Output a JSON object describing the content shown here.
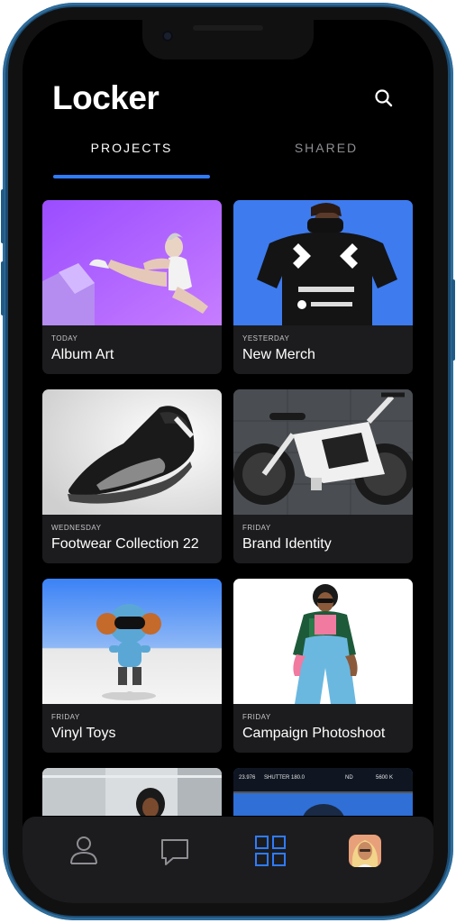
{
  "app": {
    "title": "Locker"
  },
  "tabs": [
    {
      "label": "PROJECTS",
      "active": true
    },
    {
      "label": "SHARED",
      "active": false
    }
  ],
  "projects": [
    {
      "day": "TODAY",
      "title": "Album Art",
      "thumbnail": "purple-studio-pose"
    },
    {
      "day": "YESTERDAY",
      "title": "New Merch",
      "thumbnail": "black-tshirt-on-blue"
    },
    {
      "day": "WEDNESDAY",
      "title": "Footwear Collection 22",
      "thumbnail": "black-sneaker"
    },
    {
      "day": "FRIDAY",
      "title": "Brand Identity",
      "thumbnail": "white-ebike"
    },
    {
      "day": "FRIDAY",
      "title": "Vinyl Toys",
      "thumbnail": "blue-toy-figure"
    },
    {
      "day": "FRIDAY",
      "title": "Campaign Photoshoot",
      "thumbnail": "fashion-model"
    }
  ],
  "partial_card_overlays": {
    "camera_hud": [
      "23.976",
      "SHUTTER 180.0",
      "ND",
      "5600 K"
    ]
  },
  "bottom_nav": [
    {
      "icon": "person-icon",
      "active": false
    },
    {
      "icon": "chat-icon",
      "active": false
    },
    {
      "icon": "grid-icon",
      "active": true
    },
    {
      "icon": "avatar",
      "active": false
    }
  ],
  "colors": {
    "accent": "#2f7bff",
    "background": "#000000",
    "card": "#1c1c1e",
    "frame": "#1d4a6e",
    "inactive": "#8e8e93"
  }
}
